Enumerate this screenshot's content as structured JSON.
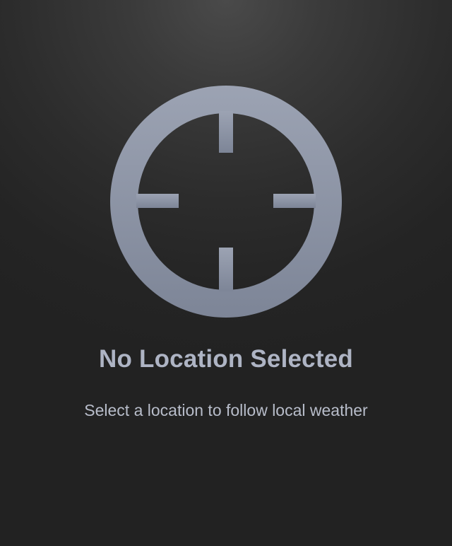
{
  "empty_state": {
    "icon": "crosshair-icon",
    "title": "No Location Selected",
    "subtitle": "Select a location to follow local weather"
  },
  "colors": {
    "icon_light": "#9ca3b3",
    "icon_dark": "#7d8597",
    "text": "#aeb4c4"
  }
}
